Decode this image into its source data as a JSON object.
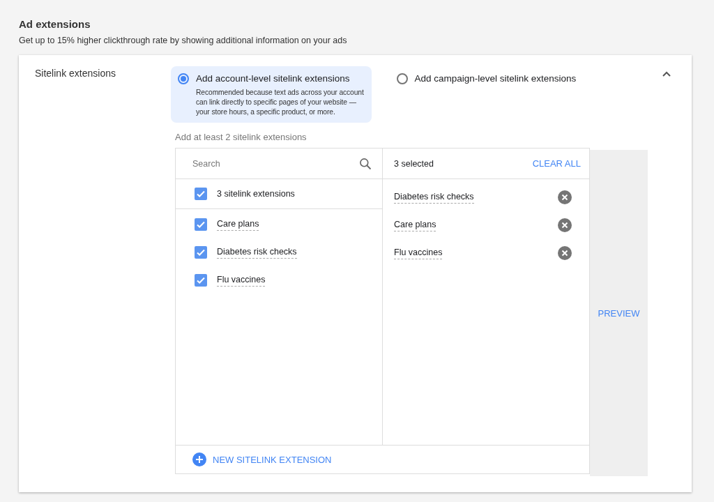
{
  "section": {
    "title": "Ad extensions",
    "subtitle": "Get up to 15% higher clickthrough rate by showing additional information on your ads"
  },
  "panel": {
    "label": "Sitelink extensions",
    "expanded": true,
    "options": [
      {
        "label": "Add account-level sitelink extensions",
        "description": "Recommended because text ads across your account can link directly to specific pages of your website — your store hours, a specific product, or more.",
        "selected": true
      },
      {
        "label": "Add campaign-level sitelink extensions",
        "selected": false
      }
    ],
    "hint": "Add at least 2 sitelink extensions",
    "search": {
      "placeholder": "Search"
    },
    "select_all": {
      "label": "3 sitelink extensions",
      "checked": true
    },
    "items": [
      {
        "label": "Care plans",
        "checked": true
      },
      {
        "label": "Diabetes risk checks",
        "checked": true
      },
      {
        "label": "Flu vaccines",
        "checked": true
      }
    ],
    "selected_count": "3 selected",
    "clear_all": "CLEAR ALL",
    "selected_items": [
      "Diabetes risk checks",
      "Care plans",
      "Flu vaccines"
    ],
    "new_button": "NEW SITELINK EXTENSION",
    "preview": "PREVIEW"
  }
}
